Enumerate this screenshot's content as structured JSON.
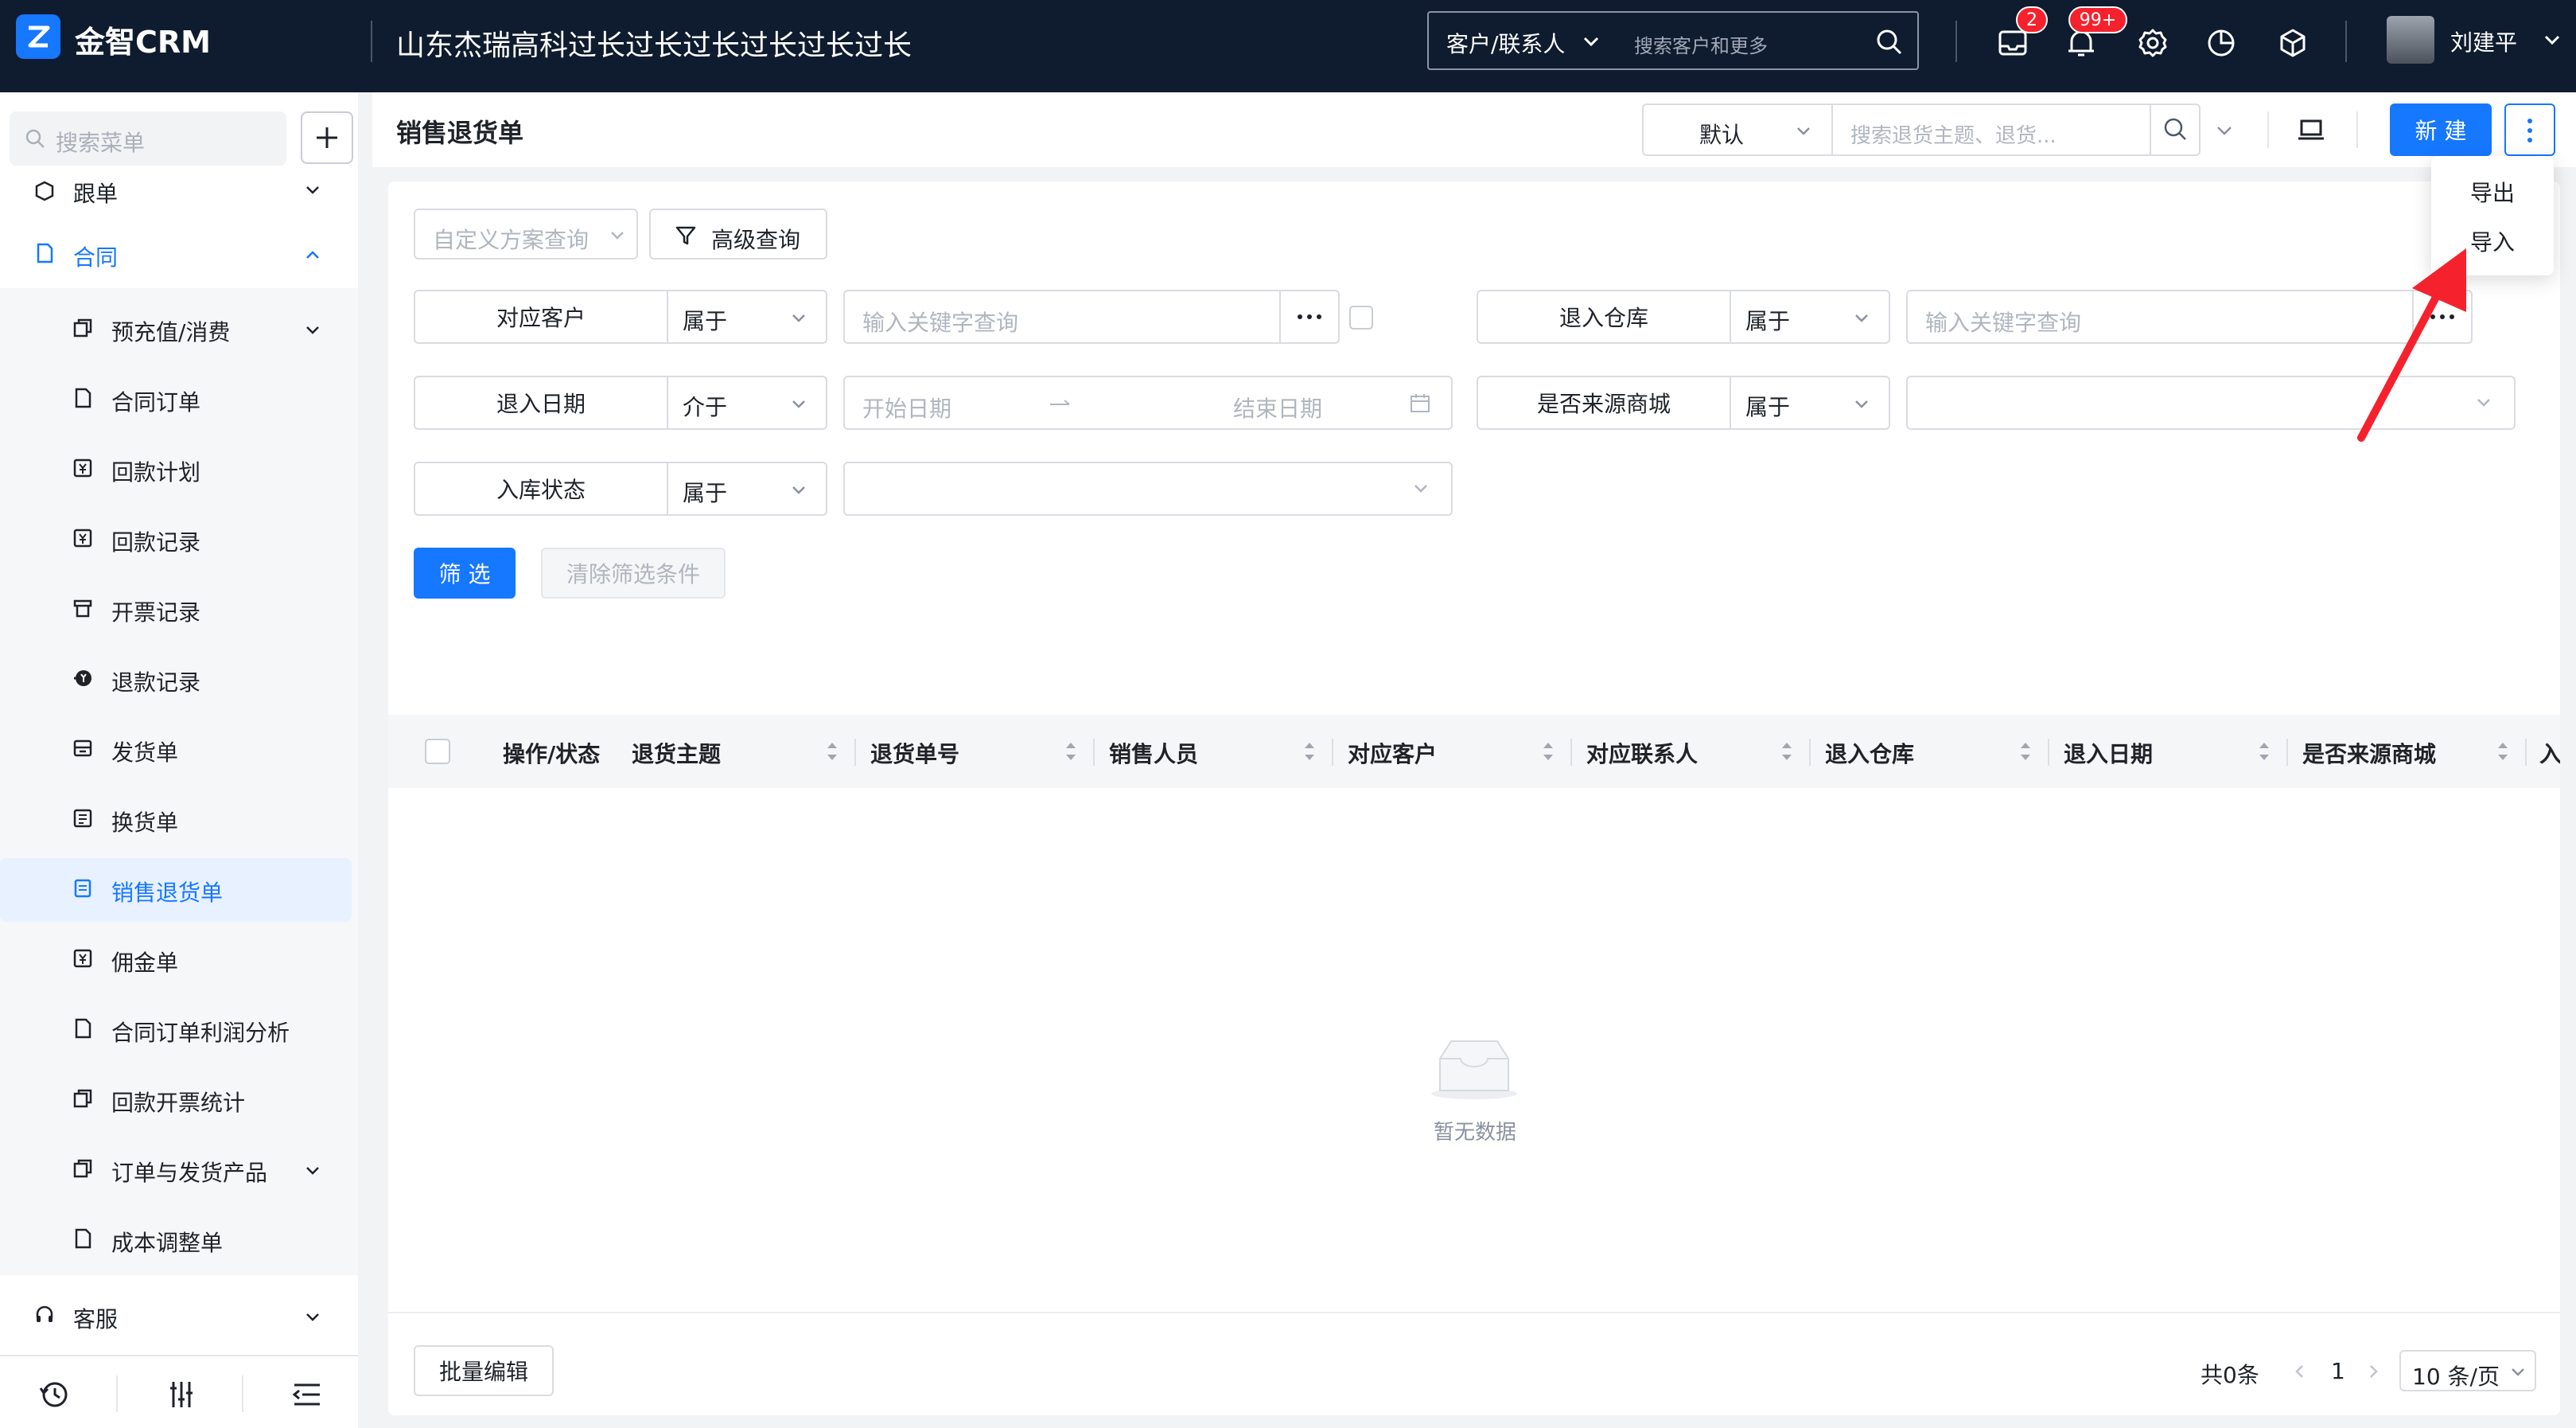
{
  "header": {
    "logo_text": "金智CRM",
    "company": "山东杰瑞高科过长过长过长过长过长过长",
    "search_scope": "客户/联系人",
    "search_placeholder": "搜索客户和更多",
    "mail_badge": "2",
    "notify_badge": "99+",
    "user_name": "刘建平"
  },
  "sidebar": {
    "search_placeholder": "搜索菜单",
    "group_followup": "跟单",
    "group_contract": "合同",
    "items": [
      {
        "label": "预充值/消费",
        "icon": "copy-icon"
      },
      {
        "label": "合同订单",
        "icon": "doc-icon"
      },
      {
        "label": "回款计划",
        "icon": "yen-icon"
      },
      {
        "label": "回款记录",
        "icon": "yen-icon"
      },
      {
        "label": "开票记录",
        "icon": "invoice-icon"
      },
      {
        "label": "退款记录",
        "icon": "refund-icon"
      },
      {
        "label": "发货单",
        "icon": "truck-icon"
      },
      {
        "label": "换货单",
        "icon": "exchange-icon"
      },
      {
        "label": "销售退货单",
        "icon": "return-icon"
      },
      {
        "label": "佣金单",
        "icon": "yen-icon"
      },
      {
        "label": "合同订单利润分析",
        "icon": "doc-icon"
      },
      {
        "label": "回款开票统计",
        "icon": "copy-icon"
      },
      {
        "label": "订单与发货产品",
        "icon": "copy-icon"
      },
      {
        "label": "成本调整单",
        "icon": "doc-icon"
      }
    ],
    "group_service": "客服"
  },
  "page": {
    "title": "销售退货单",
    "view": "默认",
    "search_placeholder": "搜索退货主题、退货...",
    "new_label": "新 建"
  },
  "more_menu": {
    "export": "导出",
    "import": "导入"
  },
  "filters": {
    "scheme_placeholder": "自定义方案查询",
    "advanced": "高级查询",
    "customer": {
      "name": "对应客户",
      "op": "属于",
      "placeholder": "输入关键字查询"
    },
    "warehouse": {
      "name": "退入仓库",
      "op": "属于",
      "placeholder": "输入关键字查询"
    },
    "date": {
      "name": "退入日期",
      "op": "介于",
      "start": "开始日期",
      "end": "结束日期"
    },
    "mall": {
      "name": "是否来源商城",
      "op": "属于"
    },
    "status": {
      "name": "入库状态",
      "op": "属于"
    },
    "filter_btn": "筛 选",
    "clear_btn": "清除筛选条件"
  },
  "table": {
    "columns": [
      "操作/状态",
      "退货主题",
      "退货单号",
      "销售人员",
      "对应客户",
      "对应联系人",
      "退入仓库",
      "退入日期",
      "是否来源商城",
      "入"
    ],
    "empty_text": "暂无数据"
  },
  "footer": {
    "batch_edit": "批量编辑",
    "total": "共0条",
    "page": "1",
    "page_size": "10 条/页"
  },
  "colors": {
    "primary": "#1677ff",
    "topbar": "#0f1b2e",
    "badge": "#f5222d",
    "arrow": "#f5222d"
  }
}
